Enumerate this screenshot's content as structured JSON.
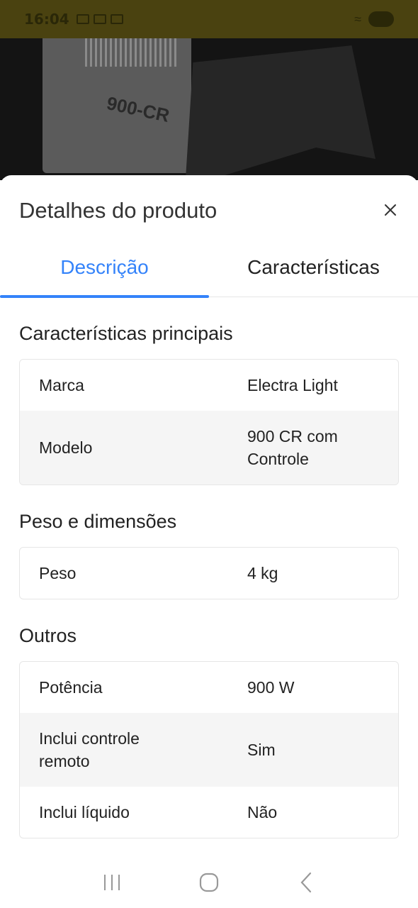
{
  "status_bar": {
    "time": "16:04"
  },
  "sheet": {
    "title": "Detalhes do produto",
    "close_label": "×"
  },
  "tabs": [
    {
      "label": "Descrição",
      "active": true
    },
    {
      "label": "Características",
      "active": false
    }
  ],
  "sections": [
    {
      "title": "Características principais",
      "rows": [
        {
          "key": "Marca",
          "value": "Electra Light"
        },
        {
          "key": "Modelo",
          "value": "900 CR com Controle"
        }
      ]
    },
    {
      "title": "Peso e dimensões",
      "rows": [
        {
          "key": "Peso",
          "value": "4 kg"
        }
      ]
    },
    {
      "title": "Outros",
      "rows": [
        {
          "key": "Potência",
          "value": "900 W"
        },
        {
          "key": "Inclui controle remoto",
          "value": "Sim"
        },
        {
          "key": "Inclui líquido",
          "value": "Não"
        }
      ]
    }
  ],
  "colors": {
    "accent": "#3483fa",
    "row_alt": "#f5f5f5"
  },
  "nav": {
    "icons": [
      "recent-apps-icon",
      "home-icon",
      "back-icon"
    ]
  }
}
